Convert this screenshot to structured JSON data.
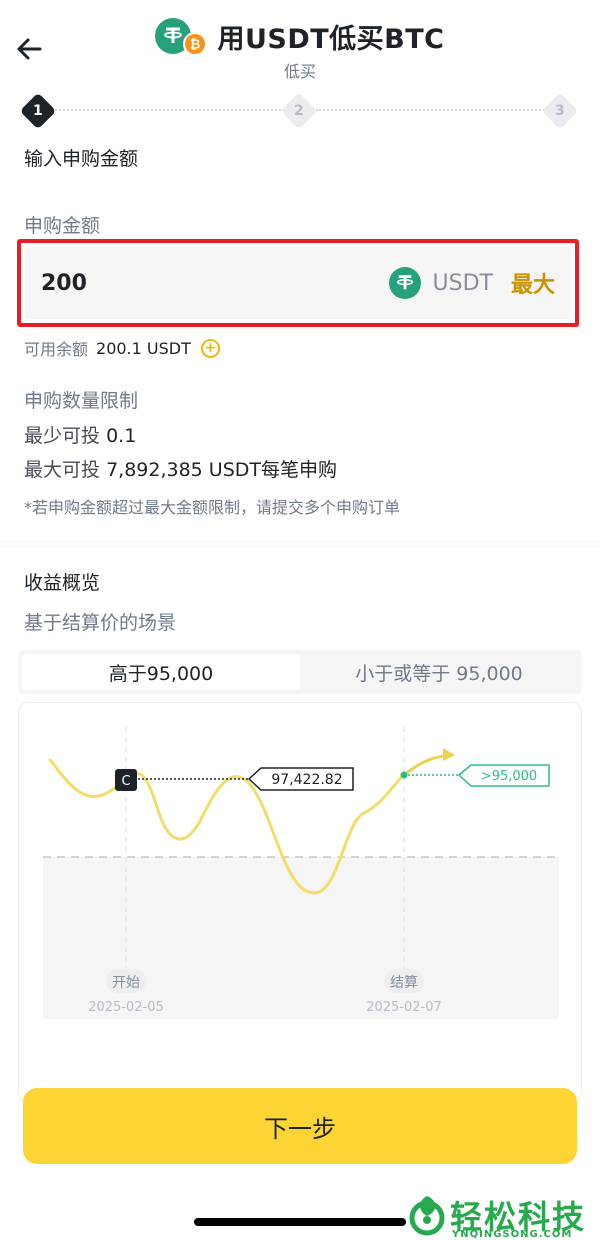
{
  "header": {
    "title": "用USDT低买BTC",
    "subtitle": "低买"
  },
  "stepper": {
    "steps": [
      "1",
      "2",
      "3"
    ],
    "active": 1
  },
  "step_title": "输入申购金额",
  "amount": {
    "label": "申购金额",
    "value": "200",
    "unit": "USDT",
    "max_label": "最大"
  },
  "balance": {
    "label": "可用余额",
    "value": "200.1 USDT"
  },
  "limits": {
    "title": "申购数量限制",
    "min_label": "最少可投",
    "min_value": "0.1",
    "max_label": "最大可投",
    "max_value": "7,892,385 USDT每笔申购",
    "note": "*若申购金额超过最大金额限制，请提交多个申购订单"
  },
  "earnings": {
    "title": "收益概览",
    "subtitle": "基于结算价的场景",
    "tabs": [
      "高于95,000",
      "小于或等于 95,000"
    ],
    "active_tab": 0
  },
  "chart_data": {
    "type": "line",
    "current_marker": "C",
    "current_price_label": "97,422.82",
    "target_label": ">95,000",
    "start_label": "开始",
    "start_date": "2025-02-05",
    "settle_label": "结算",
    "settle_date": "2025-02-07",
    "line_color": "#f0d050",
    "target_color": "#2ebd85"
  },
  "next_button": "下一步",
  "watermark": {
    "text": "轻松科技",
    "sub": "YNQINGSONG.COM"
  }
}
